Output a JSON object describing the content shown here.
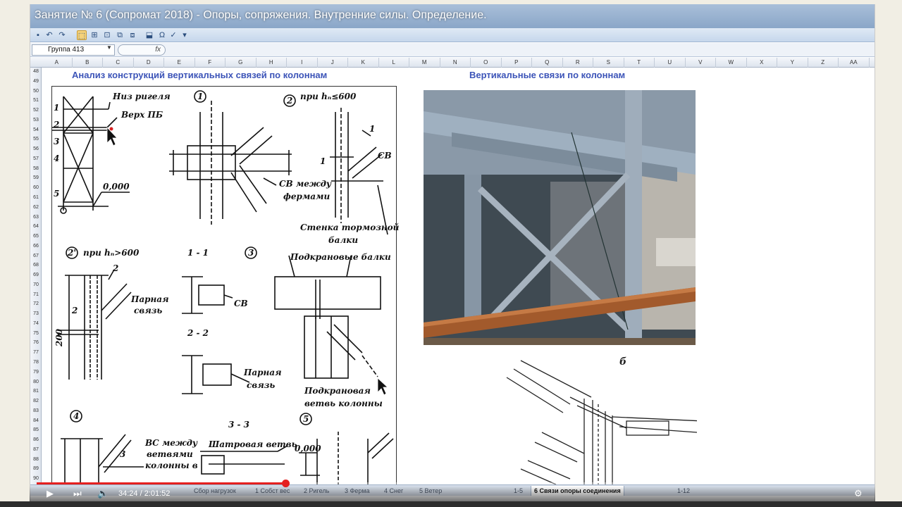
{
  "video": {
    "title": "Занятие № 6 (Сопромат 2018) - Опоры, сопряжения. Внутренние силы. Определение.",
    "time_current": "34:24",
    "time_total": "2:01:52",
    "progress": 0.3
  },
  "excel": {
    "name_box": "Группа 413",
    "fx_label": "fx",
    "columns": [
      "A",
      "B",
      "C",
      "D",
      "E",
      "F",
      "G",
      "H",
      "I",
      "J",
      "K",
      "L",
      "M",
      "N",
      "O",
      "P",
      "Q",
      "R",
      "S",
      "T",
      "U",
      "V",
      "W",
      "X",
      "Y",
      "Z",
      "AA"
    ],
    "rows": [
      "48",
      "49",
      "50",
      "51",
      "52",
      "53",
      "54",
      "55",
      "56",
      "57",
      "58",
      "59",
      "60",
      "61",
      "62",
      "63",
      "64",
      "65",
      "66",
      "67",
      "68",
      "69",
      "70",
      "71",
      "72",
      "73",
      "74",
      "75",
      "76",
      "77",
      "78",
      "79",
      "80",
      "81",
      "82",
      "83",
      "84",
      "85",
      "86",
      "87",
      "88",
      "89",
      "90"
    ],
    "headings": {
      "left": "Анализ конструкций вертикальных связей по колоннам",
      "right": "Вертикальные связи по колоннам"
    },
    "sheet_tabs": [
      {
        "label": "Сбор нагрузок",
        "active": false
      },
      {
        "label": "1 Собст вес",
        "active": false
      },
      {
        "label": "2 Ригель",
        "active": false
      },
      {
        "label": "3 Ферма",
        "active": false
      },
      {
        "label": "4 Снег",
        "active": false
      },
      {
        "label": "5 Ветер",
        "active": false
      },
      {
        "label": "1-5",
        "active": false
      },
      {
        "label": "6 Связи опоры соединения",
        "active": true
      },
      {
        "label": "1-12",
        "active": false
      }
    ]
  },
  "drawing": {
    "labels": {
      "niz_rigelya": "Низ ригеля",
      "verh_pb": "Верх ПБ",
      "n1": "1",
      "n2": "2",
      "n3": "3",
      "n4": "4",
      "n5": "5",
      "zero_mark": "0,000",
      "circ1": "1",
      "circ2": "2",
      "pri_h_le": "при hₙ≤600",
      "k1": "1",
      "k1b": "1",
      "sv": "СВ",
      "sv_mezhdu": "СВ между",
      "fermami": "фермами",
      "stenka": "Стенка тормозной",
      "balki": "балки",
      "circ2p": "2'",
      "pri_h_gt": "при hₙ>600",
      "sec11": "1 - 1",
      "circ3": "3",
      "podkranovye": "Подкрановые балки",
      "k2": "2",
      "k2b": "2",
      "parnaya": "Парная",
      "svyaz": "связь",
      "sv2": "СВ",
      "dim200": "200",
      "sec22": "2 - 2",
      "parnaya2": "Парная",
      "svyaz2": "связь",
      "podkranovaya": "Подкрановая",
      "vetv": "ветвь колонны",
      "circ4": "4",
      "sec33": "3 - 3",
      "circ5": "5",
      "k3": "3",
      "vs_mezhdu": "ВС между",
      "vetvyami": "ветвями",
      "kolonny_v": "колонны в",
      "shatrovaya": "Шатровая ветвь",
      "zero2": "0,000"
    }
  },
  "sketch": {
    "label": "б"
  }
}
